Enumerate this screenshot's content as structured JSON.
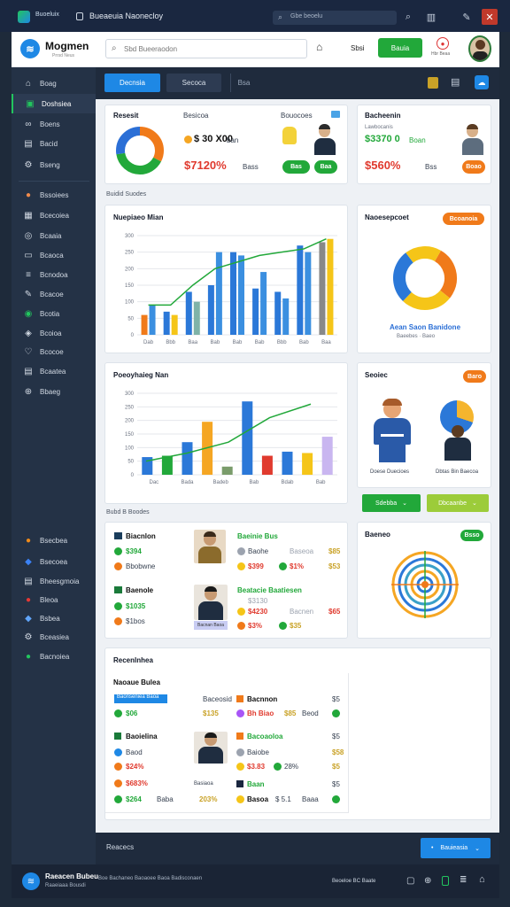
{
  "titlebar": {
    "title": "Bueaeuia Naonecloy",
    "app_badge": "Buoeluix",
    "search": "Gbe beoelu"
  },
  "header": {
    "logo": "Mogmen",
    "logo_sub": "Prrsd Neus",
    "search_placeholder": "Sbd Bueeraodon",
    "user_name": "Sbsi",
    "action_button": "Bauia",
    "badge_label": "Hbr Beaa"
  },
  "sidebar": {
    "items": [
      {
        "label": "Boag",
        "icon": "home-icon"
      },
      {
        "label": "Doshsiea",
        "icon": "dashboard-icon"
      },
      {
        "label": "Boens",
        "icon": "link-icon"
      },
      {
        "label": "Bacid",
        "icon": "doc-icon"
      },
      {
        "label": "Bseng",
        "icon": "settings-icon"
      },
      {
        "label": "Bssoiees",
        "icon": "people-icon"
      },
      {
        "label": "Bcecoiea",
        "icon": "grid-icon"
      },
      {
        "label": "Bcaaia",
        "icon": "globe-icon"
      },
      {
        "label": "Bcaoca",
        "icon": "folder-icon"
      },
      {
        "label": "Bcnodoa",
        "icon": "bars-icon"
      },
      {
        "label": "Bcacoe",
        "icon": "pen-icon"
      },
      {
        "label": "Bcotia",
        "icon": "check-icon"
      },
      {
        "label": "Bcoioa",
        "icon": "layers-icon"
      },
      {
        "label": "Bcocoe",
        "icon": "heart-icon"
      },
      {
        "label": "Bcaatea",
        "icon": "table-icon"
      },
      {
        "label": "Bbaeg",
        "icon": "globe2-icon"
      }
    ],
    "lower": [
      {
        "label": "Bsecbea",
        "icon": "orange-dot-icon"
      },
      {
        "label": "Bsecoea",
        "icon": "blue-shape-icon"
      },
      {
        "label": "Bheesgmoia",
        "icon": "doc-icon"
      },
      {
        "label": "Bleoa",
        "icon": "red-dot-icon"
      },
      {
        "label": "Bsbea",
        "icon": "diamond-icon"
      },
      {
        "label": "Bceasiea",
        "icon": "gear-icon"
      },
      {
        "label": "Bacnoiea",
        "icon": "green-dot-icon"
      }
    ]
  },
  "toolbar": {
    "tab_active": "Decnsia",
    "tab_2": "Secoca",
    "tab_3": "Bsa"
  },
  "card1": {
    "title": "Resesit",
    "col1": "Besicoa",
    "col2": "Bouocoes",
    "value1": "$ 30 X00",
    "value1_unit": "ban",
    "value2": "$7120%",
    "value2_unit": "Bass",
    "pill1": "Bas",
    "pill2": "Baa"
  },
  "card2": {
    "title": "Bacheenin",
    "subtitle": "Lawbocanis",
    "value1": "$3370 0",
    "value1_unit": "Boan",
    "value2": "$560%",
    "value2_unit": "Bss",
    "pill": "Boao"
  },
  "section1_label": "Buidid Suodes",
  "chart1": {
    "title": "Nuepiaeo Mian"
  },
  "donut2": {
    "title": "Naoesepcoet",
    "pill": "Bcoanoia",
    "caption": "Aean Saon Banidone",
    "caption2": "Baeebes · Baeo"
  },
  "chart2": {
    "title": "Poeoyhaieg Nan"
  },
  "card_people": {
    "title": "Seoiec",
    "pill": "Baro",
    "cap1": "Doese Duecioes",
    "cap2": "Dbtas Bin Baecoa",
    "btn1": "Sdebba",
    "btn2": "Dbcaanbe"
  },
  "section2_label": "Bubd B Boodes",
  "list1": {
    "rows": [
      {
        "name": "Biacnlon",
        "v1": "$394",
        "v2": "Bbobwne",
        "person": "Baeinie Bus",
        "p1": "Baohe",
        "p2": "$399",
        "p3": "$1%",
        "p4": "Baseoa",
        "amt": "$85",
        "amt2": "$53"
      },
      {
        "name": "Baenole",
        "v1": "$1035",
        "v2": "$1bos",
        "person": "Beatacie Baatiesen",
        "p1": "$3130",
        "p2": "$4230",
        "p3": "$3%",
        "p4": "Bacnen",
        "amt": "$65",
        "amt2": "$35"
      }
    ],
    "btn": "Bacnan Baoa"
  },
  "radar_card": {
    "title": "Baeneo",
    "pill": "Bsso"
  },
  "section3": {
    "title": "Recenlnhea",
    "subtitle": "Naoaue Bulea"
  },
  "table3": {
    "rows": [
      {
        "tag": "Baonseniea Baoa",
        "c1": "$06",
        "c2": "Baceosid",
        "c3": "$135",
        "c4": "Bacnnon",
        "c5": "Bh Biao",
        "c6": "$85",
        "c7": "Beod",
        "c8": "$5"
      },
      {
        "tag": "Baoielina",
        "c1": "Baod",
        "c2": "$24%",
        "c3": "Bacoaoloa",
        "c4": "$3.83",
        "c5": "Baiobe",
        "c6": "28%",
        "c7": "$5",
        "c8": "$58"
      },
      {
        "tag": "$683%",
        "c1": "$0",
        "c2": "$aa Bodds",
        "c3": "Basiaoa",
        "c4": "$5",
        "c5": "Baan",
        "c6": "$0%",
        "c7": "$55",
        "c8": "$5"
      },
      {
        "tag": "$264",
        "c1": "Baba",
        "c2": "203%",
        "c3": "Basoa",
        "c4": "$ 5.1",
        "c5": "Baaa",
        "c6": "$5",
        "c7": "$5",
        "c8": "$55"
      }
    ]
  },
  "footer": {
    "label": "Reacecs",
    "button": "Bauieasia"
  },
  "bottombar": {
    "brand": "Raeacen Bubeu",
    "sub": "Raaeiaaa Bousdi",
    "info": "Boe Bachaneo Baoaoee Baoa Badisconaen",
    "right": "Beoeloe BC Baate"
  },
  "colors": {
    "accent": "#1e88e5",
    "green": "#22a83a",
    "orange": "#f07a1a",
    "teal": "#14b8a6",
    "navy": "#1a2740"
  },
  "chart_data": [
    {
      "type": "bar",
      "title": "Nuepiaeo Mian",
      "ylim": [
        0,
        300
      ],
      "yticks": [
        "300",
        "250",
        "200",
        "150",
        "100",
        "50",
        "0"
      ],
      "categories": [
        "Dab",
        "Bbb",
        "Baa",
        "Bab",
        "Bab",
        "Bab",
        "Bbb",
        "Bab",
        "Baa"
      ],
      "series": [
        {
          "name": "",
          "values": [
            60,
            70,
            130,
            150,
            250,
            140,
            130,
            270,
            280
          ]
        },
        {
          "name": "",
          "values": [
            90,
            60,
            100,
            250,
            240,
            190,
            110,
            250,
            290
          ]
        }
      ],
      "line": [
        90,
        90,
        150,
        200,
        220,
        240,
        250,
        260,
        290
      ]
    },
    {
      "type": "bar",
      "title": "Poeoyhaieg Nan",
      "ylim": [
        0,
        300
      ],
      "yticks": [
        "300",
        "250",
        "200",
        "150",
        "100",
        "50",
        "0"
      ],
      "categories": [
        "Dac",
        "Bada",
        "Badeb",
        "Bab",
        "Bdab",
        "Bab"
      ],
      "line": [
        50,
        80,
        120,
        210,
        260
      ],
      "values": [
        65,
        70,
        120,
        195,
        30,
        270,
        70,
        85,
        80,
        140
      ]
    }
  ]
}
